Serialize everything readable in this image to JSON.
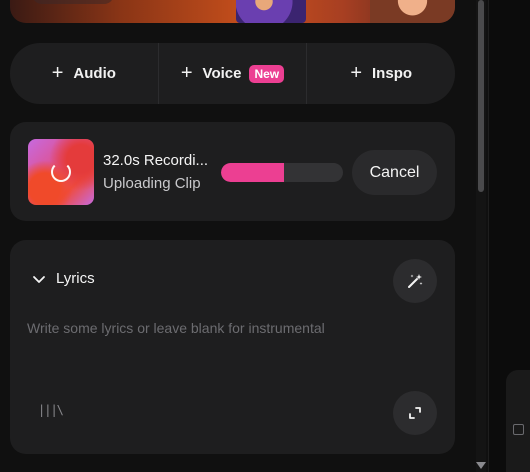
{
  "tabs": [
    {
      "label": "Audio",
      "icon": "plus-icon"
    },
    {
      "label": "Voice",
      "icon": "plus-icon",
      "badge": "New"
    },
    {
      "label": "Inspo",
      "icon": "plus-icon"
    }
  ],
  "upload": {
    "title": "32.0s Recordi...",
    "status": "Uploading Clip",
    "progress_fraction": 0.52,
    "cancel_label": "Cancel"
  },
  "lyrics": {
    "label": "Lyrics",
    "placeholder": "Write some lyrics or leave blank for instrumental",
    "library_icon_text": "|||\\"
  },
  "colors": {
    "accent": "#ec3f92",
    "card": "#1e1e1f",
    "background": "#101010"
  }
}
